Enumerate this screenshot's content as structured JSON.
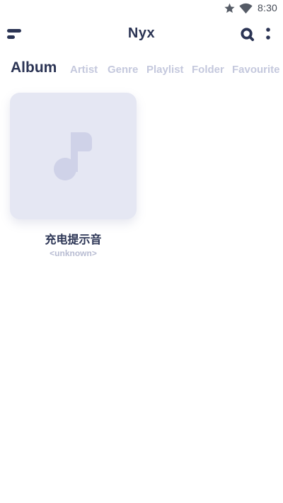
{
  "status_bar": {
    "time": "8:30",
    "icons": [
      "star-icon",
      "wifi-icon"
    ]
  },
  "app_bar": {
    "title": "Nyx",
    "left_icon": "menu-icon",
    "right_icons": [
      "search-icon",
      "more-icon"
    ]
  },
  "tabs": [
    {
      "label": "Album",
      "active": true
    },
    {
      "label": "Artist",
      "active": false
    },
    {
      "label": "Genre",
      "active": false
    },
    {
      "label": "Playlist",
      "active": false
    },
    {
      "label": "Folder",
      "active": false
    },
    {
      "label": "Favourite",
      "active": false
    }
  ],
  "albums": [
    {
      "name": "充电提示音",
      "artist": "<unknown>",
      "art_icon": "music-note-icon"
    }
  ],
  "colors": {
    "primary_text": "#2b3454",
    "inactive_tab": "#c4c8dd",
    "album_placeholder": "#e5e7f3",
    "note": "#cfd2e8",
    "secondary_text": "#b8bcd2"
  }
}
